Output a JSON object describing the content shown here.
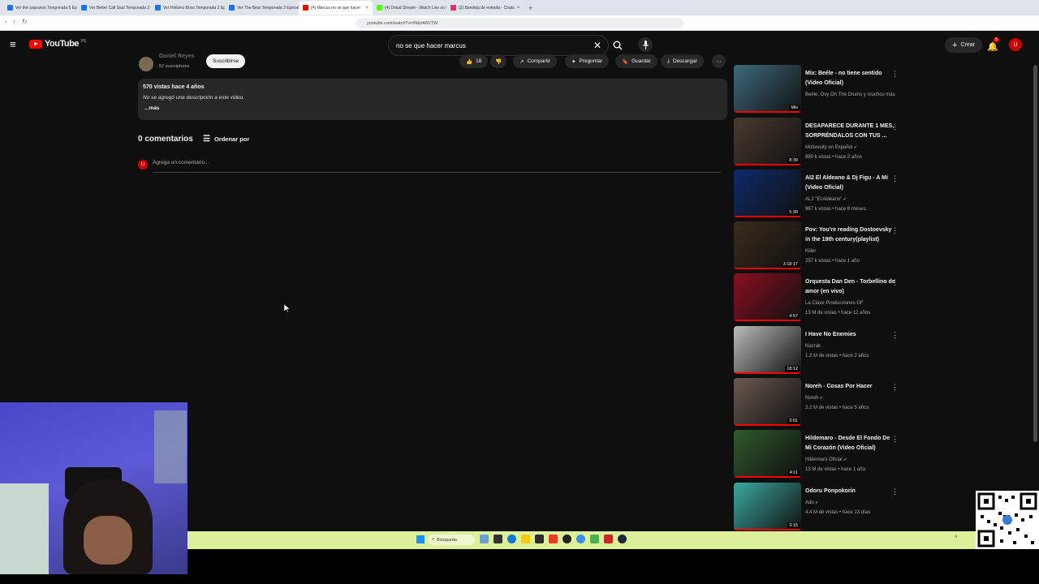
{
  "browser": {
    "tabs": [
      {
        "label": "Ver the sopranos Temporada 6 Ep...",
        "color": "#1a73e8"
      },
      {
        "label": "Ver Better Call Saul Temporada 2 Ep...",
        "color": "#1a73e8"
      },
      {
        "label": "Ver Hellsins Boss Temporada 2 Episo...",
        "color": "#1a73e8"
      },
      {
        "label": "Ver The Bear Temporada 3 Episodio...",
        "color": "#1a73e8"
      },
      {
        "label": "(4) Marcus no se que hacer",
        "color": "#ff0000",
        "active": true
      },
      {
        "label": "(4) Dstud Stream - Watch Live on Ki...",
        "color": "#53fc18"
      },
      {
        "label": "(2) Bandeja de entrada - Chats",
        "color": "#e1306c"
      }
    ],
    "new_tab": "+",
    "url": "youtube.com/watch?v=9MztA9VTW"
  },
  "youtube": {
    "logo_text": "YouTube",
    "country": "PE",
    "search_value": "no se que hacer marcus",
    "create_label": "Crear",
    "notif_count": "5",
    "avatar_letter": "U",
    "channel": {
      "name": "Daniel Reyes",
      "subs": "52 suscriptores",
      "subscribe": "Suscribirse"
    },
    "actions": {
      "likes": "18",
      "share": "Compartir",
      "ask": "Preguntar",
      "save": "Guardar",
      "download": "Descargar"
    },
    "description": {
      "stats": "570 vistas  hace 4 años",
      "text": "No se agregó una descripción a este video.",
      "more": "...más"
    },
    "comments": {
      "count_label": "0 comentarios",
      "sort": "Ordenar por",
      "placeholder": "Agrega un comentario..."
    },
    "sidebar": [
      {
        "title": "Mix: Beéle - no tiene sentido (Video Oficial)",
        "meta1": "Beéle, Ovy On The Drums y muchos más",
        "meta2": "",
        "badge": "Mix",
        "thumb": "#3d6b7c",
        "verified": false
      },
      {
        "title": "DESAPARECE DURANTE 1 MES, SORPRÉNDALOS CON TUS ...",
        "meta1": "Motivesity en Español",
        "meta2": "880 k vistas • hace 2 años",
        "badge": "8:39",
        "thumb": "#4a3b30",
        "verified": true
      },
      {
        "title": "AI2 El Aldeano & Dj Figu - A Mi (Video Oficial)",
        "meta1": "AL2 \"El Aldeano\"",
        "meta2": "967 k vistas • hace 8 meses",
        "badge": "5:30",
        "thumb": "#0d2a6b",
        "verified": true
      },
      {
        "title": "Pov: You're reading Dostoevsky in the 19th century(playlist)",
        "meta1": "Killer",
        "meta2": "257 k vistas • hace 1 año",
        "badge": "3:18:17",
        "thumb": "#3a2b1b",
        "verified": false
      },
      {
        "title": "Orquesta Dan Den - Torbellino de amor (en vivo)",
        "meta1": "La Clave Producciones GF",
        "meta2": "13 M de vistas • hace 12 años",
        "badge": "4:57",
        "thumb": "#8a1020",
        "verified": false
      },
      {
        "title": "I Have No Enemies",
        "meta1": "Nazrak",
        "meta2": "1.2 M de vistas • hace 2 años",
        "badge": "18:12",
        "thumb": "#bcbcbc",
        "verified": false
      },
      {
        "title": "Noreh - Cosas Por Hacer",
        "meta1": "Noreh",
        "meta2": "2.2 M de vistas • hace 5 años",
        "badge": "3:01",
        "thumb": "#6a5a50",
        "verified": true
      },
      {
        "title": "Hildemaro - Desde El Fondo De Mi Corazón (Video Oficial)",
        "meta1": "Hildemaro Oficial",
        "meta2": "13 M de vistas • hace 1 año",
        "badge": "4:11",
        "thumb": "#2f5a2c",
        "verified": true
      },
      {
        "title": "Odoru Ponpokorin",
        "meta1": "Ado",
        "meta2": "4.4 M de vistas • hace 13 días",
        "badge": "3:15",
        "thumb": "#3aa9a0",
        "verified": true
      }
    ]
  },
  "taskbar": {
    "search": "Búsqueda",
    "background": "#dcef9a"
  }
}
